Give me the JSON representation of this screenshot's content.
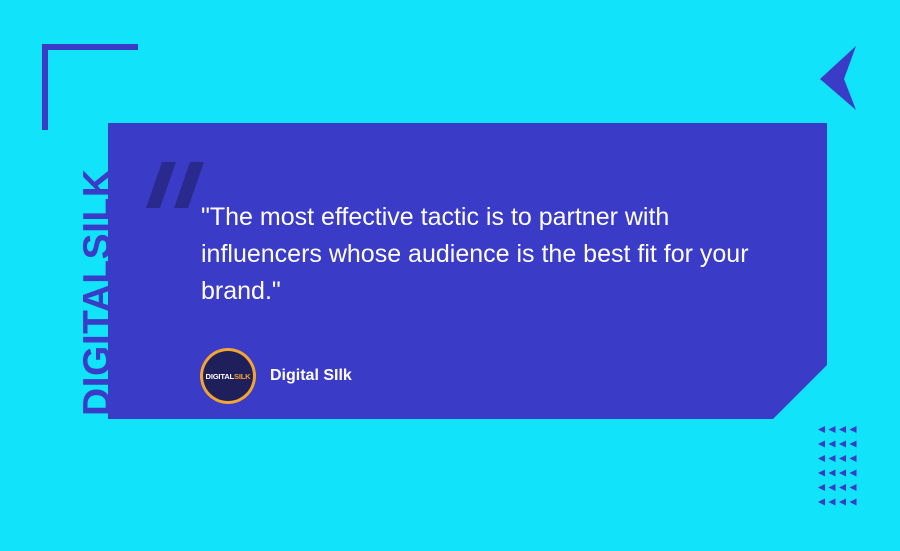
{
  "brand": {
    "side_logo_text": "DIGITALSILK",
    "avatar_logo": {
      "part1": "DIGITAL",
      "part2": "SILK"
    }
  },
  "quote": {
    "text": "\"The most effective tactic is to partner with influencers whose audience is the best fit for your brand.\""
  },
  "author": {
    "name": "Digital SIlk"
  },
  "colors": {
    "background": "#10e3fa",
    "card": "#3a3bc7",
    "accent": "#3a3bc7",
    "avatar_ring": "#f2a532",
    "avatar_fill": "#1f1f5c",
    "text": "#ffffff"
  },
  "icons": {
    "corner": "corner-bracket-icon",
    "arrow": "chevron-left-icon",
    "quote_mark": "quote-mark-icon",
    "grid": "arrow-grid-icon"
  }
}
